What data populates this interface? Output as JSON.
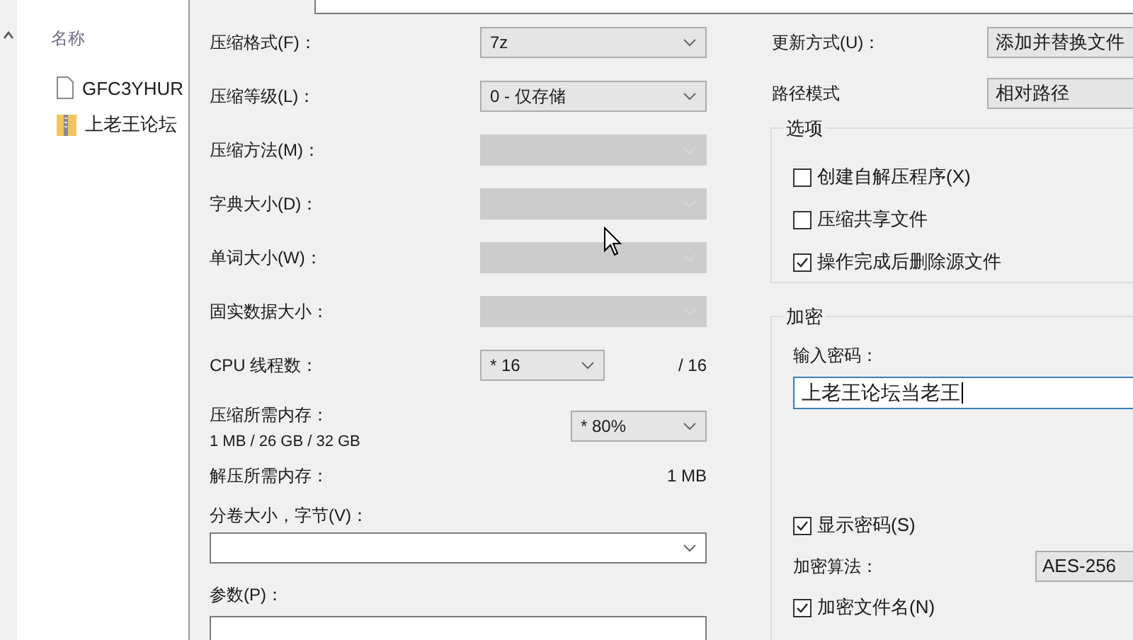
{
  "explorer": {
    "header": "名称",
    "files": [
      {
        "name": "GFC3YHUR",
        "kind": "file"
      },
      {
        "name": "上老王论坛",
        "kind": "archive"
      }
    ]
  },
  "left_rows": [
    {
      "label": "压缩格式(F)：",
      "value": "7z",
      "disabled": false
    },
    {
      "label": "压缩等级(L)：",
      "value": "0 - 仅存储",
      "disabled": false
    },
    {
      "label": "压缩方法(M)：",
      "disabled": true
    },
    {
      "label": "字典大小(D)：",
      "disabled": true
    },
    {
      "label": "单词大小(W)：",
      "disabled": true
    },
    {
      "label": "固实数据大小：",
      "disabled": true
    }
  ],
  "threads": {
    "label": "CPU 线程数：",
    "value": "* 16",
    "max": "/ 16"
  },
  "memory": {
    "label": "压缩所需内存：",
    "detail": "1 MB / 26 GB / 32 GB",
    "value": "* 80%"
  },
  "decompress_memory": {
    "label": "解压所需内存：",
    "value": "1 MB"
  },
  "volume": {
    "label": "分卷大小，字节(V)："
  },
  "parameters": {
    "label": "参数(P)："
  },
  "update_mode": {
    "label": "更新方式(U)：",
    "value": "添加并替换文件"
  },
  "path_mode": {
    "label": "路径模式",
    "value": "相对路径"
  },
  "options": {
    "title": "选项",
    "items": [
      {
        "label": "创建自解压程序(X)",
        "checked": false
      },
      {
        "label": "压缩共享文件",
        "checked": false
      },
      {
        "label": "操作完成后删除源文件",
        "checked": true
      }
    ]
  },
  "encryption": {
    "title": "加密",
    "password_label": "输入密码：",
    "password": "上老王论坛当老王",
    "show_password": {
      "label": "显示密码(S)",
      "checked": true
    },
    "method_label": "加密算法：",
    "method": "AES-256",
    "encrypt_names": {
      "label": "加密文件名(N)",
      "checked": true
    }
  }
}
